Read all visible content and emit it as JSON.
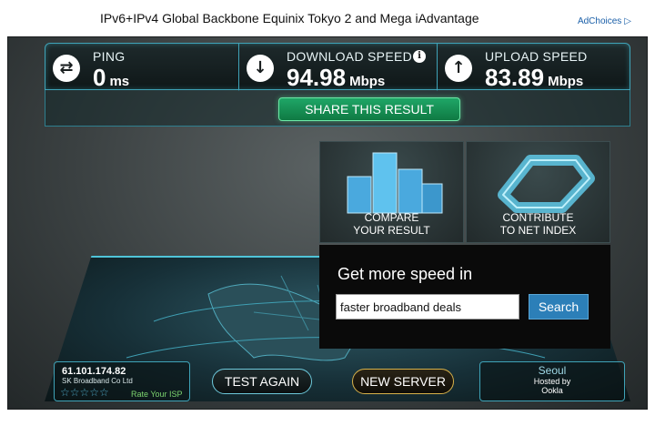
{
  "banner": {
    "title": "IPv6+IPv4 Global Backbone Equinix Tokyo 2 and Mega iAdvantage",
    "adchoices": "AdChoices"
  },
  "stats": {
    "ping": {
      "label": "PING",
      "value": "0",
      "unit": "ms"
    },
    "download": {
      "label": "DOWNLOAD SPEED",
      "value": "94.98",
      "unit": "Mbps"
    },
    "upload": {
      "label": "UPLOAD SPEED",
      "value": "83.89",
      "unit": "Mbps"
    }
  },
  "share": {
    "label": "SHARE THIS RESULT"
  },
  "tiles": {
    "compare": {
      "line1": "COMPARE",
      "line2": "YOUR RESULT"
    },
    "contribute": {
      "line1": "CONTRIBUTE",
      "line2": "TO NET INDEX"
    }
  },
  "promo": {
    "title": "Get more speed in",
    "input_value": "faster broadband deals",
    "search_label": "Search"
  },
  "isp": {
    "ip": "61.101.174.82",
    "name": "SK Broadband Co Ltd",
    "stars": "☆☆☆☆☆",
    "rating_label": "Rate Your ISP"
  },
  "buttons": {
    "test_again": "TEST AGAIN",
    "new_server": "NEW SERVER"
  },
  "server": {
    "city": "Seoul",
    "hosted_by": "Hosted by",
    "host": "Ookla"
  },
  "colors": {
    "accent_teal": "#3fa3b8",
    "share_green": "#1fa667",
    "search_blue": "#2c7fb8",
    "new_server_gold": "#d8b24a"
  },
  "icons": {
    "ping": "swap-arrows-icon",
    "download": "arrow-down-icon",
    "upload": "arrow-up-icon"
  }
}
